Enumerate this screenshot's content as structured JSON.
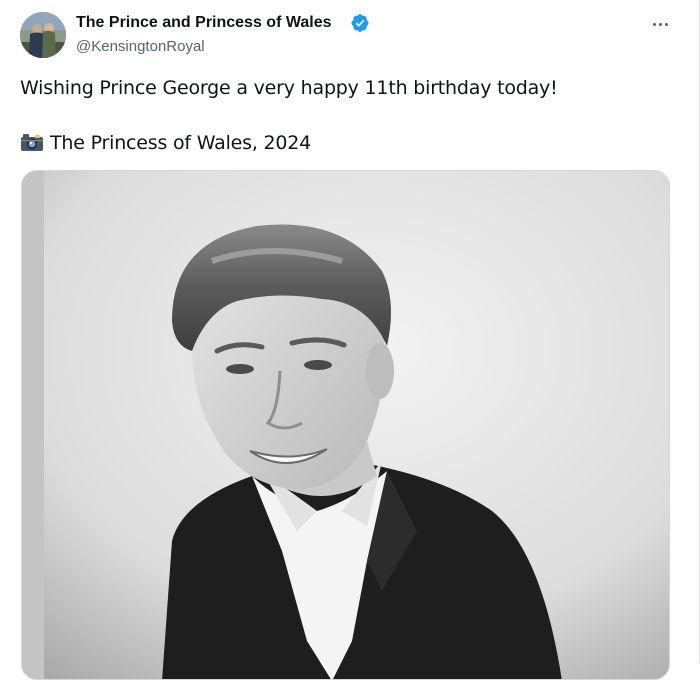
{
  "author": {
    "name": "The Prince and Princess of Wales",
    "handle": "@KensingtonRoyal",
    "verified": true
  },
  "tweet": {
    "line1": "Wishing Prince George a very happy 11th birthday today!",
    "line2_icon": "camera-flash-icon",
    "line2": "The Princess of Wales, 2024"
  },
  "media": {
    "description_icon": "photo"
  },
  "colors": {
    "text": "#0f1419",
    "secondary": "#536471",
    "verified": "#1d9bf0",
    "border": "#cfd9de"
  }
}
